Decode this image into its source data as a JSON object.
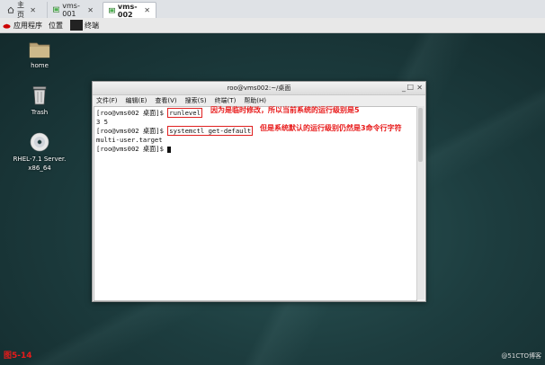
{
  "host_tabs": [
    {
      "label": "主页"
    },
    {
      "label": "vms-001"
    },
    {
      "label": "vms-002"
    }
  ],
  "panel": {
    "applications": "应用程序",
    "places": "位置",
    "terminal": "终端"
  },
  "desktop_icons": [
    {
      "label": "home",
      "icon": "folder-icon"
    },
    {
      "label": "Trash",
      "icon": "trash-icon"
    },
    {
      "label_line1": "RHEL-7.1 Server.",
      "label_line2": "x86_64",
      "icon": "disc-icon"
    }
  ],
  "terminal": {
    "title": "roo@vms002:~/桌面",
    "menu": [
      "文件(F)",
      "编辑(E)",
      "查看(V)",
      "搜索(S)",
      "终端(T)",
      "帮助(H)"
    ],
    "prompt": "[roo@vms002 桌面]$",
    "lines": [
      {
        "command": "runlevel",
        "annotation": "因为是临时修改，所以当前系统的运行级别是5"
      },
      {
        "output": "3 5"
      },
      {
        "command": "systemctl get-default",
        "annotation": "但是系统默认的运行级别仍然是3命令行字符"
      },
      {
        "output": "multi-user.target"
      }
    ]
  },
  "figure_label": "图5-14",
  "watermark": "@51CTO博客",
  "colors": {
    "annotation": "#e81b1b",
    "desktop": "#1d3d3f"
  }
}
